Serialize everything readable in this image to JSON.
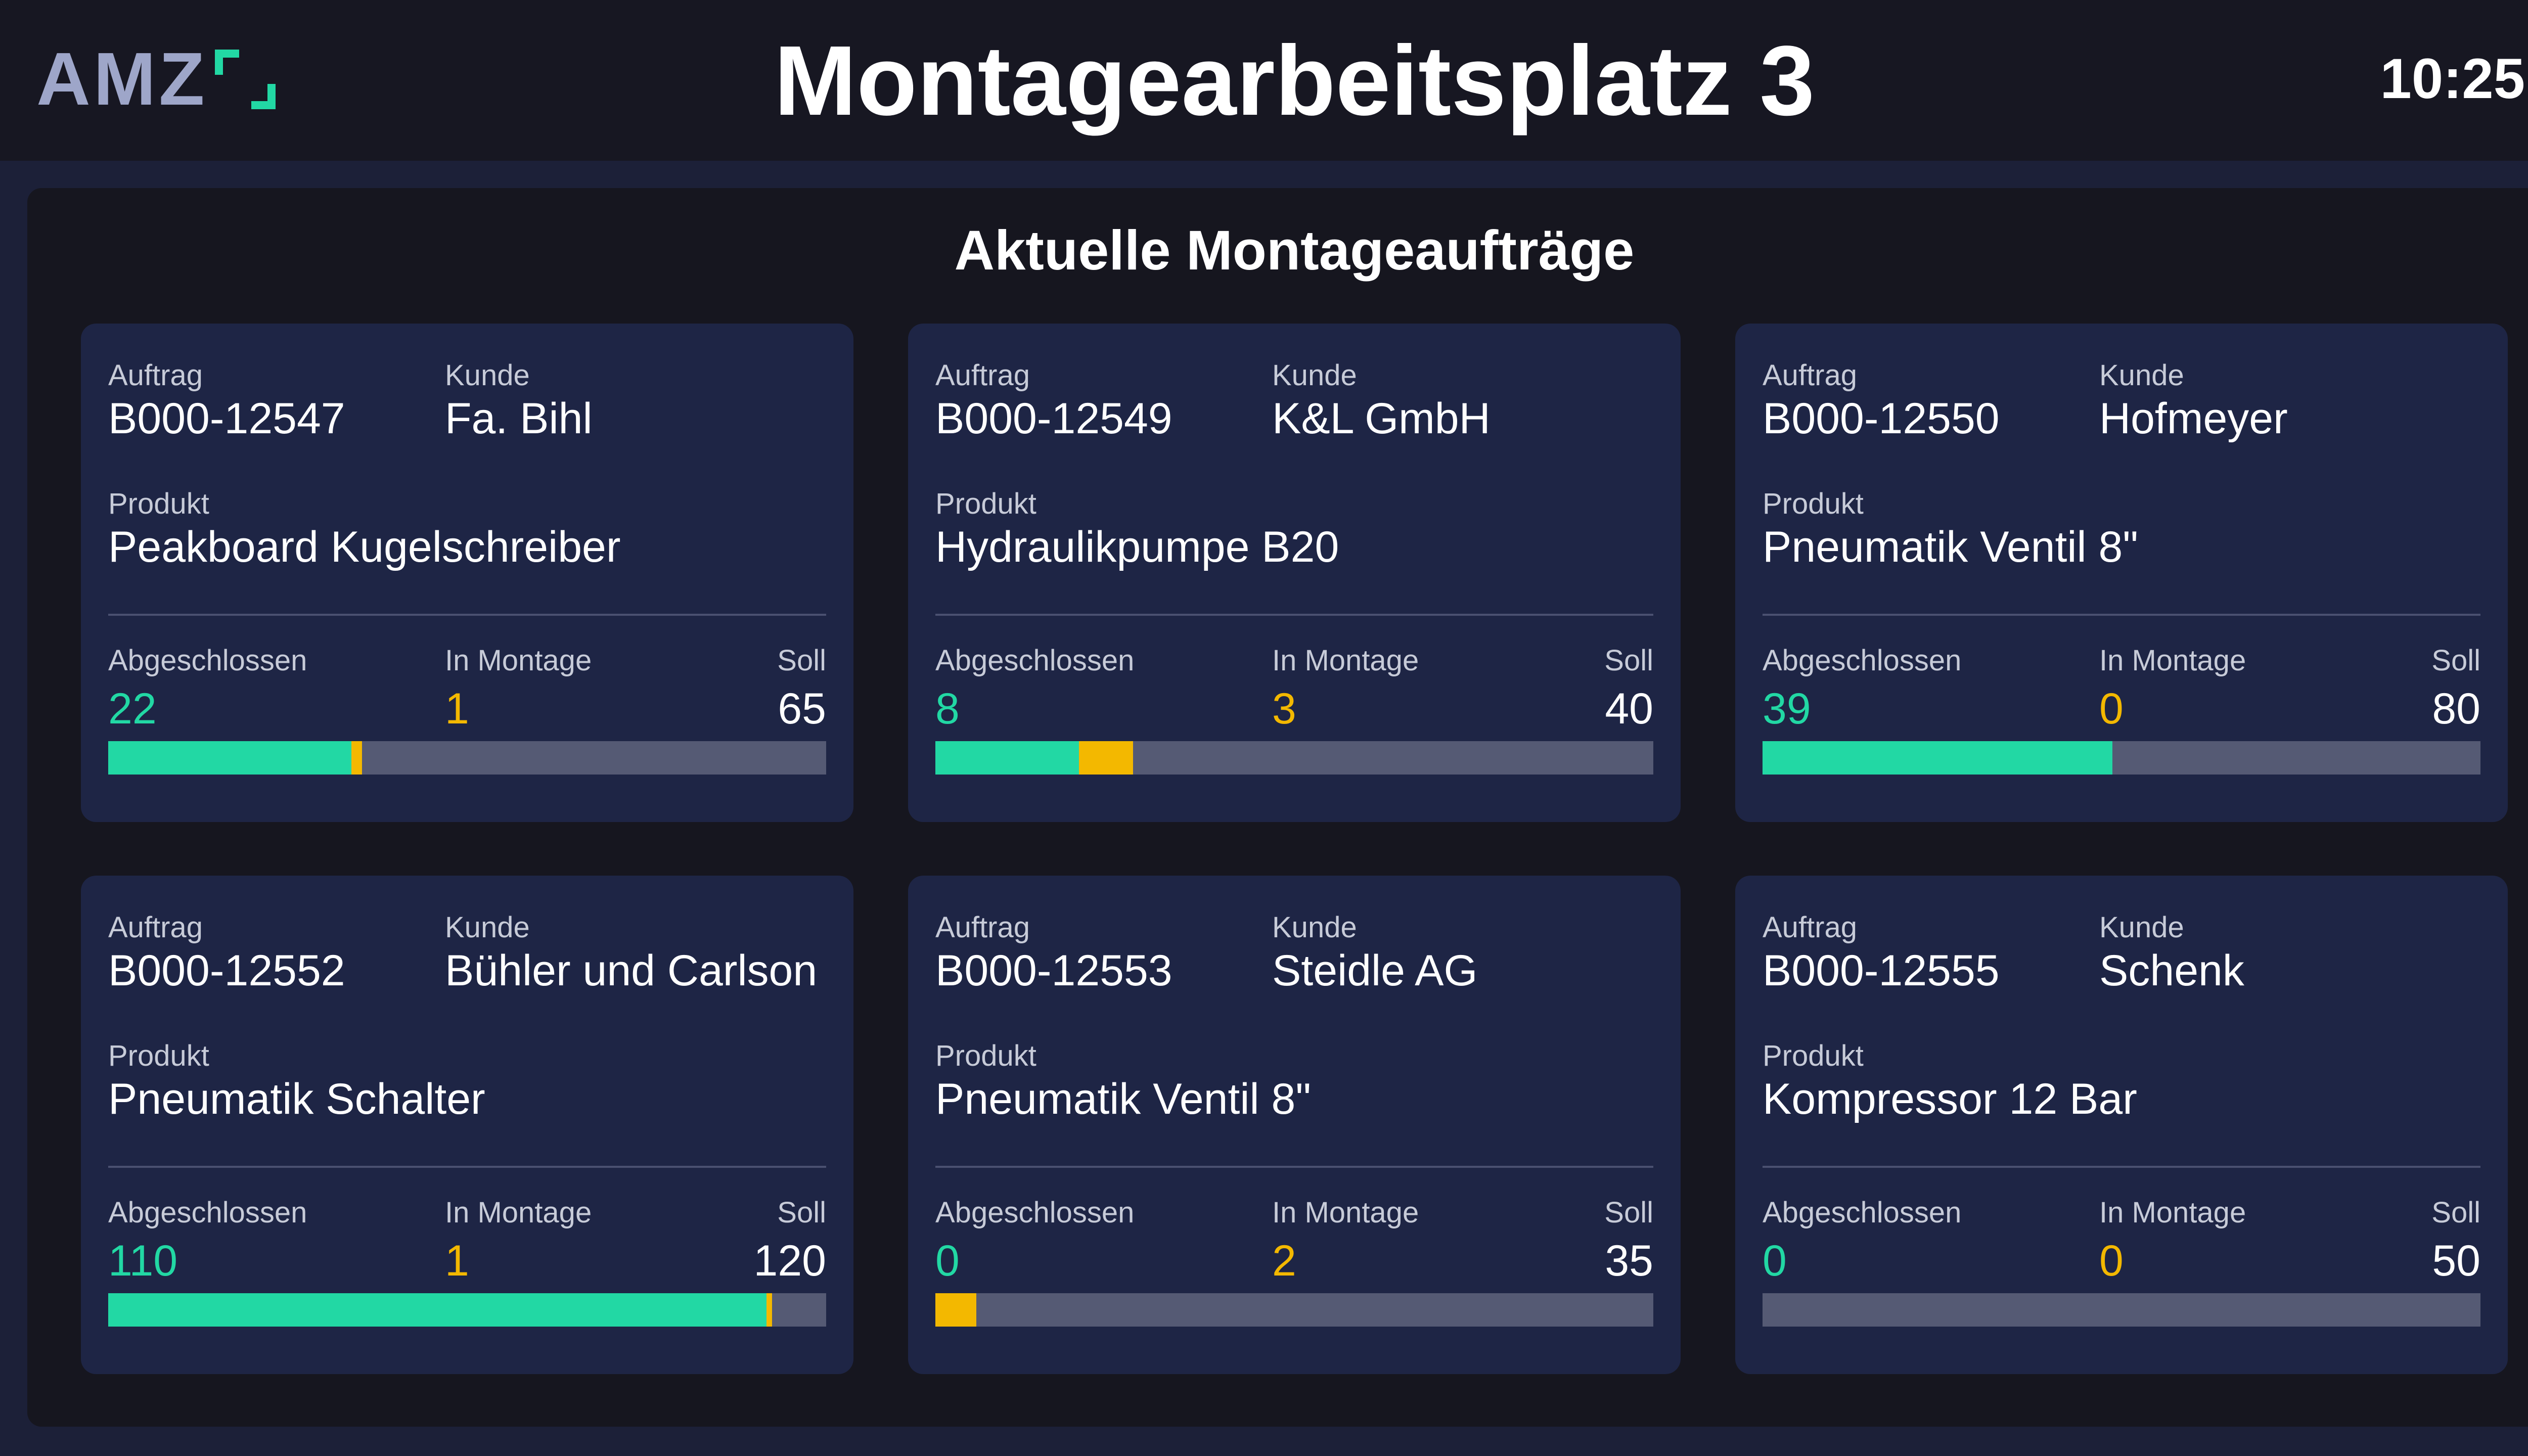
{
  "header": {
    "logo_text": "AMZ",
    "title": "Montagearbeitsplatz 3",
    "time": "10:25"
  },
  "panel": {
    "title": "Aktuelle Montageaufträge"
  },
  "labels": {
    "order": "Auftrag",
    "customer": "Kunde",
    "product": "Produkt",
    "done": "Abgeschlossen",
    "in_assembly": "In Montage",
    "target": "Soll"
  },
  "colors": {
    "done": "#22d8a4",
    "in_assembly": "#f3b800",
    "remaining": "#555a74"
  },
  "orders": [
    {
      "order": "B000-12547",
      "customer": "Fa. Bihl",
      "product": "Peakboard Kugelschreiber",
      "done": 22,
      "in_assembly": 1,
      "target": 65
    },
    {
      "order": "B000-12549",
      "customer": "K&L GmbH",
      "product": "Hydraulikpumpe B20",
      "done": 8,
      "in_assembly": 3,
      "target": 40
    },
    {
      "order": "B000-12550",
      "customer": "Hofmeyer",
      "product": "Pneumatik Ventil 8\"",
      "done": 39,
      "in_assembly": 0,
      "target": 80
    },
    {
      "order": "B000-12552",
      "customer": "Bühler und Carlson",
      "product": "Pneumatik Schalter",
      "done": 110,
      "in_assembly": 1,
      "target": 120
    },
    {
      "order": "B000-12553",
      "customer": "Steidle AG",
      "product": "Pneumatik Ventil 8\"",
      "done": 0,
      "in_assembly": 2,
      "target": 35
    },
    {
      "order": "B000-12555",
      "customer": "Schenk",
      "product": "Kompressor 12 Bar",
      "done": 0,
      "in_assembly": 0,
      "target": 50
    }
  ]
}
